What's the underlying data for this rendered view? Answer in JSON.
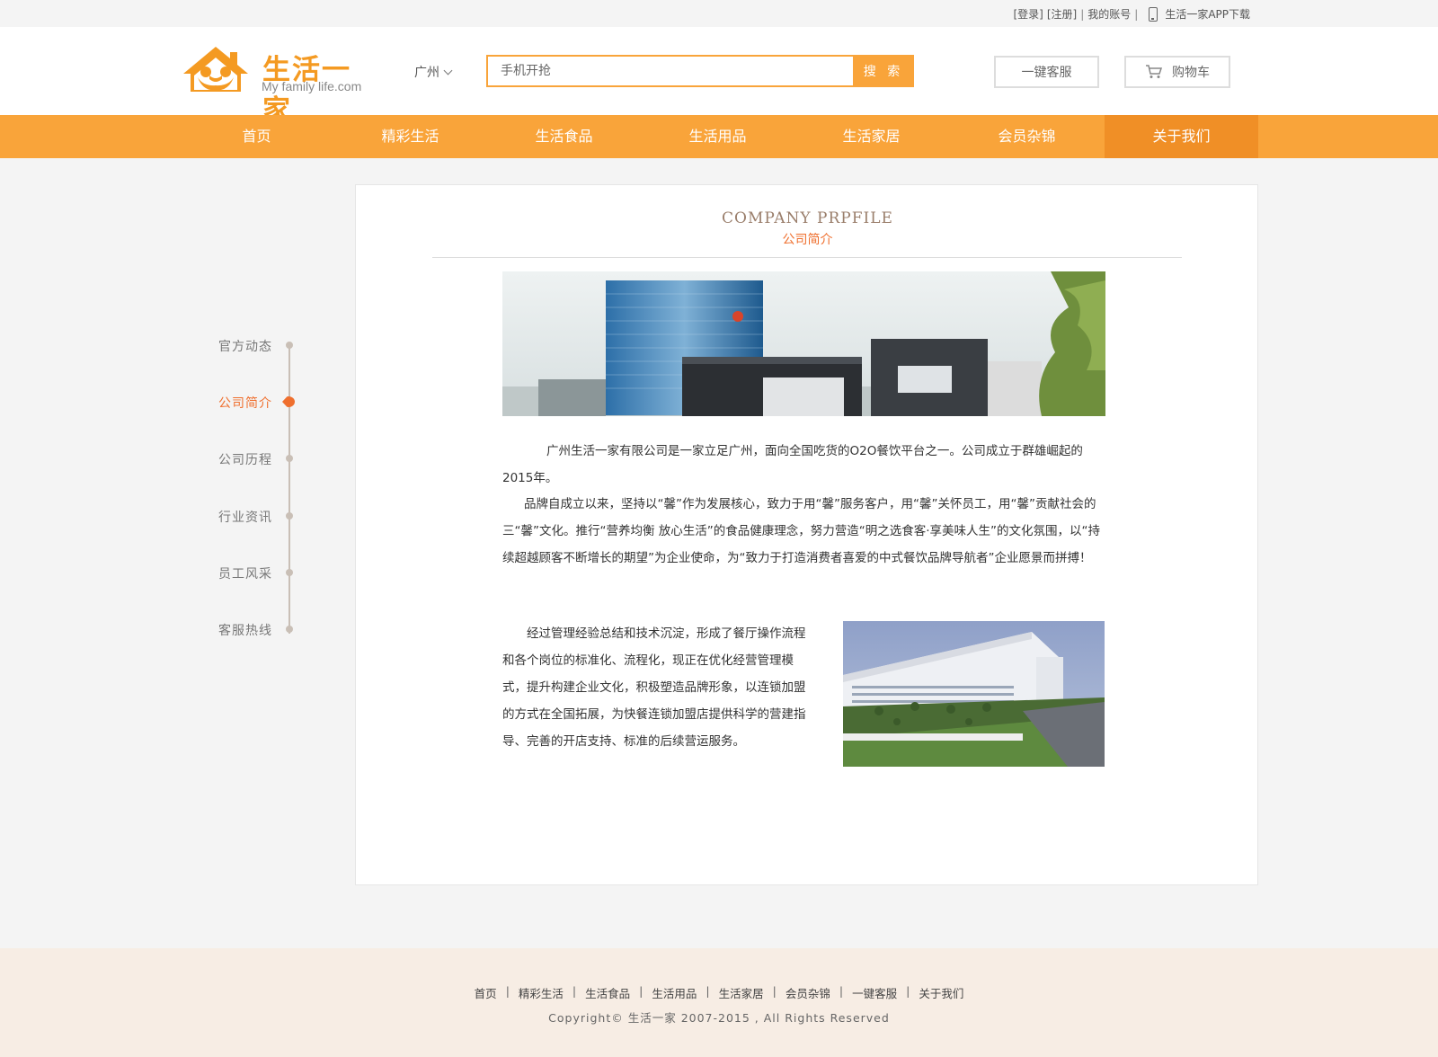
{
  "topbar": {
    "login": "[登录]",
    "register": "[注册]",
    "account": "我的账号",
    "sep": "|",
    "app_download": "生活一家APP下载"
  },
  "header": {
    "logo_text": "生活一家",
    "logo_sub": "My family life.com",
    "city": "广州",
    "search_placeholder": "手机开抢",
    "search_button": "搜 索",
    "service_button": "一键客服",
    "cart_button": "购物车"
  },
  "colors": {
    "brand_orange": "#f9a43a",
    "nav_active": "#f08f26",
    "accent": "#ef6f2e"
  },
  "nav": {
    "items": [
      {
        "label": "首页"
      },
      {
        "label": "精彩生活"
      },
      {
        "label": "生活食品"
      },
      {
        "label": "生活用品"
      },
      {
        "label": "生活家居"
      },
      {
        "label": "会员杂锦"
      },
      {
        "label": "关于我们"
      }
    ],
    "active_index": 6
  },
  "sidebar": {
    "items": [
      {
        "label": "官方动态"
      },
      {
        "label": "公司简介"
      },
      {
        "label": "公司历程"
      },
      {
        "label": "行业资讯"
      },
      {
        "label": "员工风采"
      },
      {
        "label": "客服热线"
      }
    ],
    "active_index": 1
  },
  "content": {
    "title_en": "COMPANY PRPFILE",
    "title_zh": "公司简介",
    "para1": "广州生活一家有限公司是一家立足广州，面向全国吃货的O2O餐饮平台之一。公司成立于群雄崛起的2015年。",
    "para2": "品牌自成立以来，坚持以“馨”作为发展核心，致力于用“馨”服务客户，用“馨”关怀员工，用“馨”贡献社会的三“馨”文化。推行“营养均衡 放心生活”的食品健康理念，努力营造“明之选食客·享美味人生”的文化氛围，以“持续超越顾客不断增长的期望”为企业使命，为“致力于打造消费者喜爱的中式餐饮品牌导航者”企业愿景而拼搏！",
    "para3": "经过管理经验总结和技术沉淀，形成了餐厅操作流程和各个岗位的标准化、流程化，现正在优化经营管理模式，提升构建企业文化，积极塑造品牌形象，以连锁加盟的方式在全国拓展，为快餐连锁加盟店提供科学的营建指导、完善的开店支持、标准的后续营运服务。"
  },
  "footer": {
    "links": [
      {
        "label": "首页"
      },
      {
        "label": "精彩生活"
      },
      {
        "label": "生活食品"
      },
      {
        "label": "生活用品"
      },
      {
        "label": "生活家居"
      },
      {
        "label": "会员杂锦"
      },
      {
        "label": "一键客服"
      },
      {
        "label": "关于我们"
      }
    ],
    "sep": "|",
    "copyright": "Copyright© 生活一家 2007-2015 , All Rights Reserved"
  }
}
